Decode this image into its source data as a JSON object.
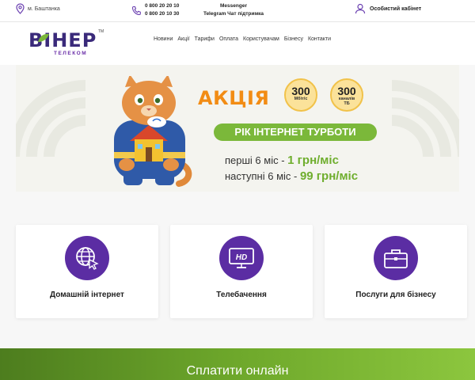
{
  "topbar": {
    "location": "м. Баштанка",
    "phones": [
      "0 800 20 20 10",
      "0 800 20 10 30"
    ],
    "support": [
      "Messenger",
      "Telegram Чат підтримка"
    ],
    "cabinet_label": "Особистий кабінет"
  },
  "logo": {
    "text": "ВІНЕР",
    "sub": "ТЕЛЕКОМ",
    "tm": "TM"
  },
  "nav": [
    "Новини",
    "Акції",
    "Тарифи",
    "Оплата",
    "Користувачам",
    "Бізнесу",
    "Контакти"
  ],
  "banner": {
    "title": "АКЦІЯ",
    "speed_value": "300",
    "speed_unit": "Мбіт/с",
    "plus": "+",
    "channels_value": "300",
    "channels_unit": "каналів",
    "channels_unit2": "ТБ",
    "ribbon": "РІК ІНТЕРНЕТ ТУРБОТИ",
    "line1_prefix": "перші 6 міс - ",
    "line1_price": "1 грн/міс",
    "line2_prefix": "наступні 6 міс - ",
    "line2_price": "99 грн/міс"
  },
  "cards": [
    {
      "label": "Домашній інтернет",
      "icon": "globe-cursor-icon"
    },
    {
      "label": "Телебачення",
      "icon": "hd-tv-icon"
    },
    {
      "label": "Послуги для бізнесу",
      "icon": "briefcase-icon"
    }
  ],
  "pay": {
    "label": "Сплатити онлайн"
  },
  "colors": {
    "brand_purple": "#5b2da3",
    "brand_green": "#7bb83a",
    "promo_orange": "#f28c14"
  }
}
